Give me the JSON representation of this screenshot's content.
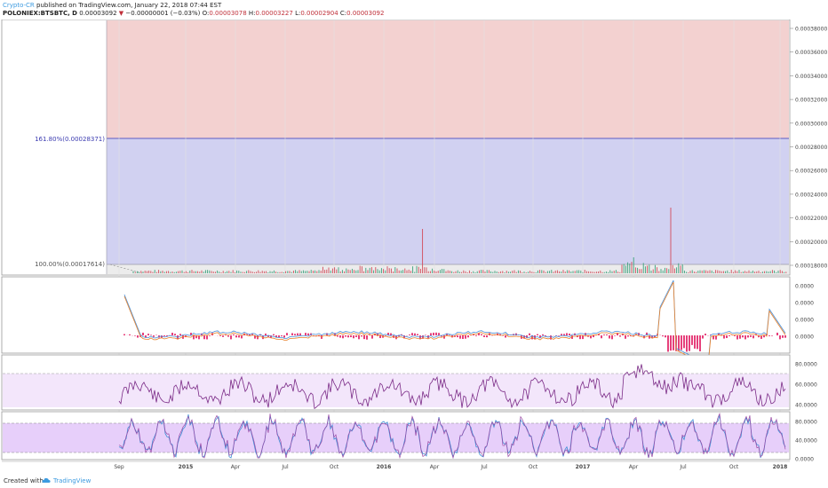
{
  "header": {
    "author": "Crypto-CR",
    "published": "published on TradingView.com, January 22, 2018 07:44 EST",
    "symbol": "POLONIEX:BTSBTC, D",
    "last": "0.00003092",
    "change": "−0.00000001 (−0.03%)",
    "o_label": "O:",
    "o_value": "0.00003078",
    "h_label": "H:",
    "h_value": "0.00003227",
    "l_label": "L:",
    "l_value": "0.00002904",
    "c_label": "C:",
    "c_value": "0.00003092"
  },
  "fib": {
    "level_1618": "161.80%(0.00028371)",
    "level_100": "100.00%(0.00017614)"
  },
  "price_axis": [
    "0.00038000",
    "0.00036000",
    "0.00034000",
    "0.00032000",
    "0.00030000",
    "0.00028000",
    "0.00026000",
    "0.00024000",
    "0.00022000",
    "0.00020000",
    "0.00018000"
  ],
  "macd_axis": [
    "0.0000",
    "0.0000",
    "0.0000",
    "0.0000"
  ],
  "rsi_axis": [
    "80.0000",
    "60.0000",
    "40.0000"
  ],
  "stoch_axis": [
    "80.0000",
    "40.0000",
    "0.0000"
  ],
  "time_axis": [
    "Sep",
    "2015",
    "Apr",
    "Jul",
    "Oct",
    "2016",
    "Apr",
    "Jul",
    "Oct",
    "2017",
    "Apr",
    "Jul",
    "Oct",
    "2018"
  ],
  "colors": {
    "fib_upper": "#f3d1d0",
    "fib_lower": "#d1d1f1",
    "fib_line": "#5b5bc4",
    "rsi_band": "#f3e6fb",
    "stoch_band": "#e7cffa",
    "up": "#3aa07a",
    "down": "#d24b5a",
    "macd_hist": "#e0105a"
  },
  "footer": {
    "created": "Created with",
    "brand": "TradingView"
  }
}
